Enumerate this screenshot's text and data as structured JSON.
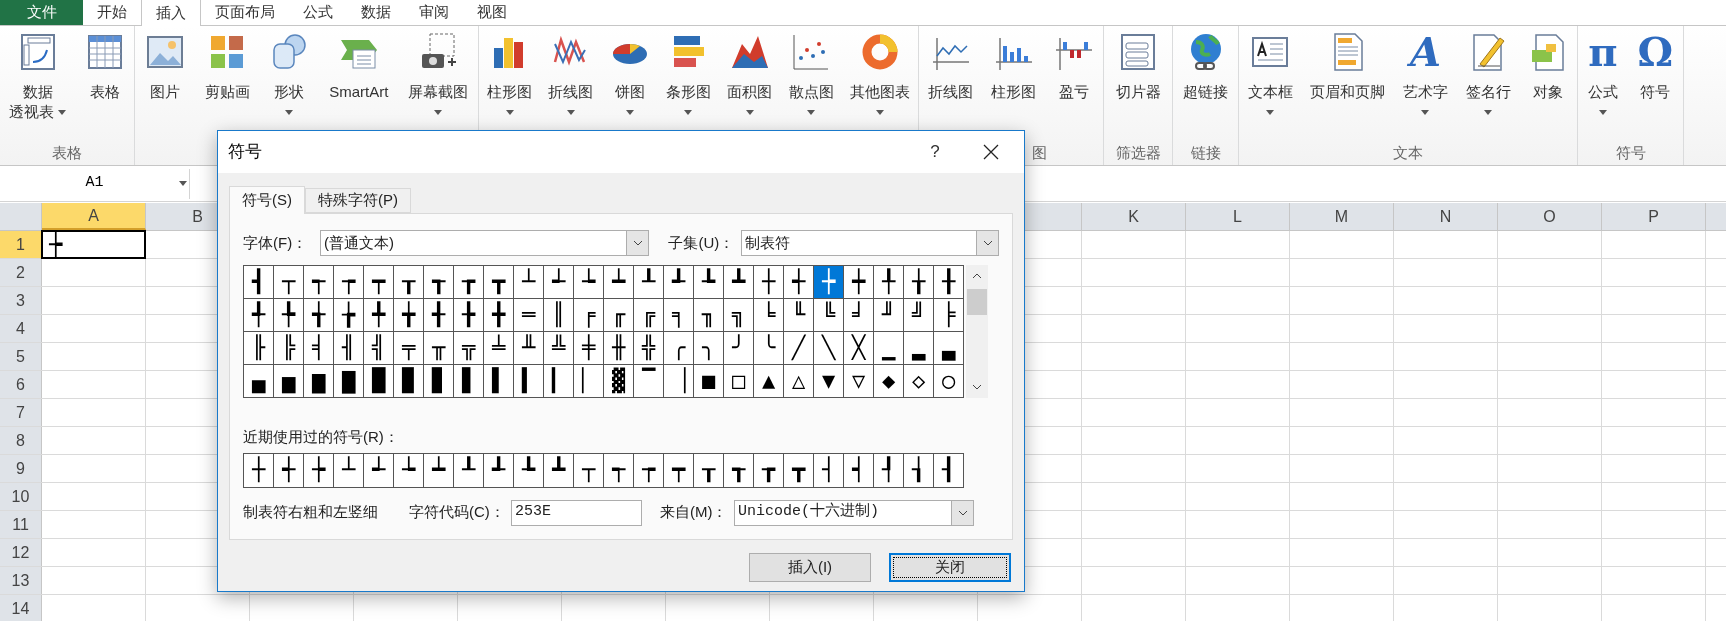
{
  "menu_tabs": [
    {
      "label": "文件",
      "kind": "file",
      "selected": false
    },
    {
      "label": "开始",
      "kind": "tab",
      "selected": false
    },
    {
      "label": "插入",
      "kind": "tab",
      "selected": true
    },
    {
      "label": "页面布局",
      "kind": "tab",
      "selected": false
    },
    {
      "label": "公式",
      "kind": "tab",
      "selected": false
    },
    {
      "label": "数据",
      "kind": "tab",
      "selected": false
    },
    {
      "label": "审阅",
      "kind": "tab",
      "selected": false
    },
    {
      "label": "视图",
      "kind": "tab",
      "selected": false
    }
  ],
  "ribbon_groups": [
    {
      "label": "表格",
      "buttons": [
        {
          "label": "数据",
          "label_line2": "透视表",
          "kind": "pivot",
          "dropdown": true
        },
        {
          "label": "表格",
          "kind": "table",
          "dropdown": false
        }
      ]
    },
    {
      "buttons": [
        {
          "label": "图片",
          "kind": "picture",
          "dropdown": false
        },
        {
          "label": "剪贴画",
          "kind": "clipart",
          "dropdown": false
        },
        {
          "label": "形状",
          "kind": "shapes",
          "dropdown": true
        },
        {
          "label": "SmartArt",
          "kind": "smartart",
          "dropdown": false
        },
        {
          "label": "屏幕截图",
          "kind": "screenshot",
          "dropdown": true
        }
      ]
    },
    {
      "buttons": [
        {
          "label": "柱形图",
          "kind": "column",
          "dropdown": true
        },
        {
          "label": "折线图",
          "kind": "line",
          "dropdown": true
        },
        {
          "label": "饼图",
          "kind": "pie",
          "dropdown": true
        },
        {
          "label": "条形图",
          "kind": "bar",
          "dropdown": true
        },
        {
          "label": "面积图",
          "kind": "area",
          "dropdown": true
        },
        {
          "label": "散点图",
          "kind": "scatter",
          "dropdown": true
        },
        {
          "label": "其他图表",
          "kind": "donut",
          "dropdown": true
        }
      ]
    },
    {
      "label": "图",
      "buttons": [
        {
          "label": "折线图",
          "kind": "sparkline",
          "dropdown": false
        },
        {
          "label": "柱形图",
          "kind": "sparkcolumn",
          "dropdown": false
        },
        {
          "label": "盈亏",
          "kind": "winloss",
          "dropdown": false
        }
      ]
    },
    {
      "label": "筛选器",
      "buttons": [
        {
          "label": "切片器",
          "kind": "slicer",
          "dropdown": false
        }
      ]
    },
    {
      "label": "链接",
      "buttons": [
        {
          "label": "超链接",
          "kind": "globe",
          "dropdown": false
        }
      ]
    },
    {
      "label": "文本",
      "buttons": [
        {
          "label": "文本框",
          "kind": "textbox",
          "dropdown": true
        },
        {
          "label": "页眉和页脚",
          "kind": "header",
          "dropdown": false
        },
        {
          "label": "艺术字",
          "kind": "wordart",
          "glyph": "A",
          "dropdown": true
        },
        {
          "label": "签名行",
          "kind": "signature",
          "dropdown": true
        },
        {
          "label": "对象",
          "kind": "object",
          "dropdown": false
        }
      ]
    },
    {
      "label": "符号",
      "buttons": [
        {
          "label": "公式",
          "kind": "glyph",
          "glyph": "π",
          "dropdown": true
        },
        {
          "label": "符号",
          "kind": "glyph",
          "glyph": "Ω",
          "dropdown": false
        }
      ]
    }
  ],
  "name_box": "A1",
  "columns_left": [
    {
      "label": "A",
      "selected": true
    },
    {
      "label": "B",
      "selected": false
    }
  ],
  "columns_right": [
    {
      "label": "K",
      "selected": false
    },
    {
      "label": "L",
      "selected": false
    },
    {
      "label": "M",
      "selected": false
    },
    {
      "label": "N",
      "selected": false
    },
    {
      "label": "O",
      "selected": false
    },
    {
      "label": "P",
      "selected": false
    }
  ],
  "rows": [
    {
      "label": "1",
      "selected": true
    },
    {
      "label": "2",
      "selected": false
    },
    {
      "label": "3",
      "selected": false
    },
    {
      "label": "4",
      "selected": false
    },
    {
      "label": "5",
      "selected": false
    },
    {
      "label": "6",
      "selected": false
    },
    {
      "label": "7",
      "selected": false
    },
    {
      "label": "8",
      "selected": false
    },
    {
      "label": "9",
      "selected": false
    },
    {
      "label": "10",
      "selected": false
    },
    {
      "label": "11",
      "selected": false
    },
    {
      "label": "12",
      "selected": false
    },
    {
      "label": "13",
      "selected": false
    },
    {
      "label": "14",
      "selected": false
    }
  ],
  "active_cell_value": "┾",
  "dialog": {
    "title": "符号",
    "help": "?",
    "tabs": [
      {
        "label": "符号(S)",
        "selected": true
      },
      {
        "label": "特殊字符(P)",
        "selected": false
      }
    ],
    "font_label": "字体(F)：",
    "font_value": "(普通文本)",
    "subset_label": "子集(U)：",
    "subset_value": "制表符",
    "symbol_rows": [
      [
        {
          "char": "┫",
          "selected": false
        },
        {
          "char": "┬",
          "selected": false
        },
        {
          "char": "┭",
          "selected": false
        },
        {
          "char": "┮",
          "selected": false
        },
        {
          "char": "┯",
          "selected": false
        },
        {
          "char": "┰",
          "selected": false
        },
        {
          "char": "┱",
          "selected": false
        },
        {
          "char": "┲",
          "selected": false
        },
        {
          "char": "┳",
          "selected": false
        },
        {
          "char": "┴",
          "selected": false
        },
        {
          "char": "┵",
          "selected": false
        },
        {
          "char": "┶",
          "selected": false
        },
        {
          "char": "┷",
          "selected": false
        },
        {
          "char": "┸",
          "selected": false
        },
        {
          "char": "┹",
          "selected": false
        },
        {
          "char": "┺",
          "selected": false
        },
        {
          "char": "┻",
          "selected": false
        },
        {
          "char": "┼",
          "selected": false
        },
        {
          "char": "┽",
          "selected": false
        },
        {
          "char": "┾",
          "selected": true
        },
        {
          "char": "┿",
          "selected": false
        },
        {
          "char": "╀",
          "selected": false
        },
        {
          "char": "╁",
          "selected": false
        },
        {
          "char": "╂",
          "selected": false
        }
      ],
      [
        {
          "char": "╃",
          "selected": false
        },
        {
          "char": "╄",
          "selected": false
        },
        {
          "char": "╅",
          "selected": false
        },
        {
          "char": "╆",
          "selected": false
        },
        {
          "char": "╇",
          "selected": false
        },
        {
          "char": "╈",
          "selected": false
        },
        {
          "char": "╉",
          "selected": false
        },
        {
          "char": "╊",
          "selected": false
        },
        {
          "char": "╋",
          "selected": false
        },
        {
          "char": "═",
          "selected": false
        },
        {
          "char": "║",
          "selected": false
        },
        {
          "char": "╒",
          "selected": false
        },
        {
          "char": "╓",
          "selected": false
        },
        {
          "char": "╔",
          "selected": false
        },
        {
          "char": "╕",
          "selected": false
        },
        {
          "char": "╖",
          "selected": false
        },
        {
          "char": "╗",
          "selected": false
        },
        {
          "char": "╘",
          "selected": false
        },
        {
          "char": "╙",
          "selected": false
        },
        {
          "char": "╚",
          "selected": false
        },
        {
          "char": "╛",
          "selected": false
        },
        {
          "char": "╜",
          "selected": false
        },
        {
          "char": "╝",
          "selected": false
        },
        {
          "char": "╞",
          "selected": false
        }
      ],
      [
        {
          "char": "╟",
          "selected": false
        },
        {
          "char": "╠",
          "selected": false
        },
        {
          "char": "╡",
          "selected": false
        },
        {
          "char": "╢",
          "selected": false
        },
        {
          "char": "╣",
          "selected": false
        },
        {
          "char": "╤",
          "selected": false
        },
        {
          "char": "╥",
          "selected": false
        },
        {
          "char": "╦",
          "selected": false
        },
        {
          "char": "╧",
          "selected": false
        },
        {
          "char": "╨",
          "selected": false
        },
        {
          "char": "╩",
          "selected": false
        },
        {
          "char": "╪",
          "selected": false
        },
        {
          "char": "╫",
          "selected": false
        },
        {
          "char": "╬",
          "selected": false
        },
        {
          "char": "╭",
          "selected": false
        },
        {
          "char": "╮",
          "selected": false
        },
        {
          "char": "╯",
          "selected": false
        },
        {
          "char": "╰",
          "selected": false
        },
        {
          "char": "╱",
          "selected": false
        },
        {
          "char": "╲",
          "selected": false
        },
        {
          "char": "╳",
          "selected": false
        },
        {
          "char": "▁",
          "selected": false
        },
        {
          "char": "▂",
          "selected": false
        },
        {
          "char": "▃",
          "selected": false
        }
      ],
      [
        {
          "char": "▄",
          "selected": false
        },
        {
          "char": "▅",
          "selected": false
        },
        {
          "char": "▆",
          "selected": false
        },
        {
          "char": "▇",
          "selected": false
        },
        {
          "char": "█",
          "selected": false
        },
        {
          "char": "▉",
          "selected": false
        },
        {
          "char": "▊",
          "selected": false
        },
        {
          "char": "▋",
          "selected": false
        },
        {
          "char": "▌",
          "selected": false
        },
        {
          "char": "▍",
          "selected": false
        },
        {
          "char": "▎",
          "selected": false
        },
        {
          "char": "▏",
          "selected": false
        },
        {
          "char": "▓",
          "selected": false
        },
        {
          "char": "▔",
          "selected": false
        },
        {
          "char": "▕",
          "selected": false
        },
        {
          "char": "■",
          "selected": false
        },
        {
          "char": "□",
          "selected": false
        },
        {
          "char": "▲",
          "selected": false
        },
        {
          "char": "△",
          "selected": false
        },
        {
          "char": "▼",
          "selected": false
        },
        {
          "char": "▽",
          "selected": false
        },
        {
          "char": "◆",
          "selected": false
        },
        {
          "char": "◇",
          "selected": false
        },
        {
          "char": "○",
          "selected": false
        }
      ]
    ],
    "recent_label": "近期使用过的符号(R)：",
    "recent": [
      "┼",
      "┽",
      "┾",
      "┴",
      "┵",
      "┶",
      "┷",
      "┸",
      "┹",
      "┺",
      "┻",
      "┬",
      "┭",
      "┮",
      "┯",
      "┰",
      "┱",
      "┲",
      "┳",
      "┤",
      "┥",
      "┦",
      "┧",
      "┨"
    ],
    "description": "制表符右粗和左竖细",
    "code_label": "字符代码(C)：",
    "code_value": "253E",
    "from_label": "来自(M)：",
    "from_value": "Unicode(十六进制)",
    "buttons": [
      {
        "label": "插入(I)",
        "default": false
      },
      {
        "label": "关闭",
        "default": true
      }
    ]
  }
}
